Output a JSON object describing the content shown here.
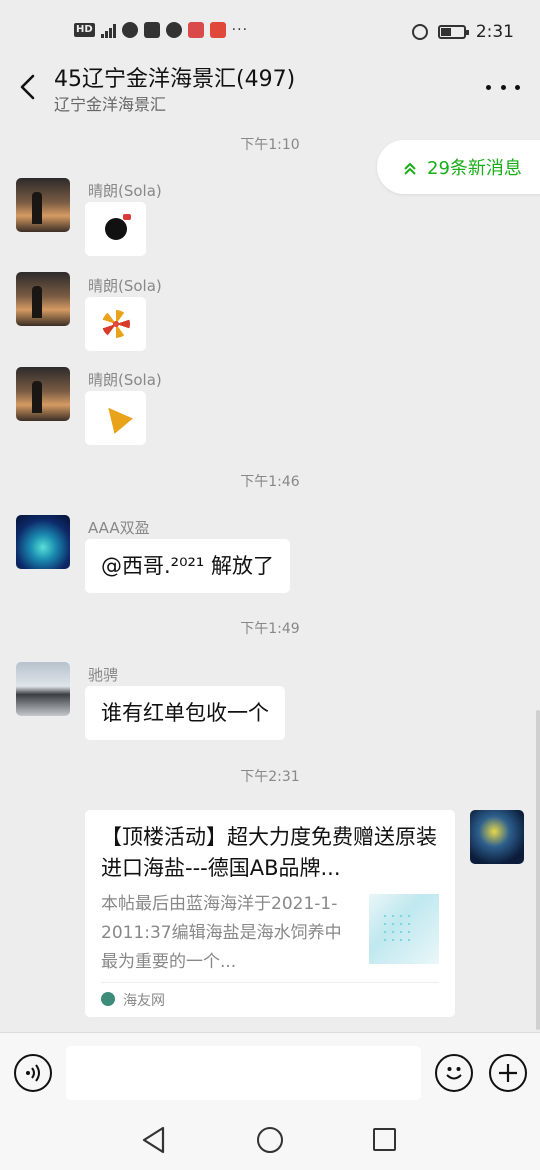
{
  "status_bar": {
    "network": "HD",
    "time": "2:31"
  },
  "header": {
    "title": "45辽宁金洋海景汇(497)",
    "subtitle": "辽宁金洋海景汇"
  },
  "new_messages": {
    "label": "29条新消息"
  },
  "messages": {
    "t1": "下午1:10",
    "m1_sender": "晴朗(Sola)",
    "m2_sender": "晴朗(Sola)",
    "m3_sender": "晴朗(Sola)",
    "t2": "下午1:46",
    "m4_sender": "AAA双盈",
    "m4_text": "@西哥.²⁰²¹ 解放了",
    "t3": "下午1:49",
    "m5_sender": "驰骋",
    "m5_text": "谁有红单包收一个",
    "t4": "下午2:31"
  },
  "link_card": {
    "title": "【顶楼活动】超大力度免费赠送原装进口海盐---德国AB品牌...",
    "description": "本帖最后由蓝海海洋于2021-1-2011:37编辑海盐是海水饲养中最为重要的一个...",
    "source": "海友网"
  },
  "input": {
    "placeholder": ""
  },
  "icons": {
    "voice": "voice-icon",
    "emoji": "emoji-icon",
    "plus": "plus-icon",
    "back": "back-arrow-icon",
    "more": "more-dots-icon"
  },
  "colors": {
    "accent_green": "#1aad19",
    "background": "#ededed",
    "bubble": "#ffffff"
  }
}
